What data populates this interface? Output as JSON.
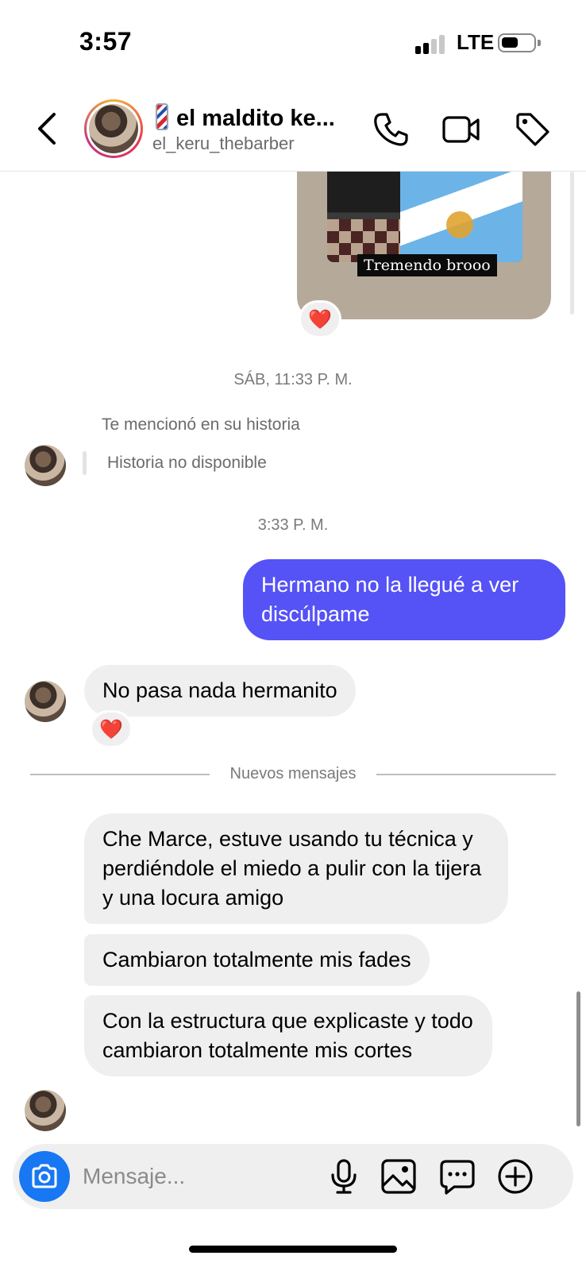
{
  "status_bar": {
    "time": "3:57",
    "network": "LTE",
    "battery_level": 0.4
  },
  "header": {
    "contact_name": "el maldito ke...",
    "contact_username": "el_keru_thebarber",
    "icons": [
      "back-chevron",
      "phone",
      "video-camera",
      "tag"
    ]
  },
  "chat": {
    "story": {
      "caption": "Tremendo brooo",
      "reaction": "❤️"
    },
    "timestamp_1": "SÁB, 11:33 P. M.",
    "mention_text": "Te mencionó en su historia",
    "story_unavailable": "Historia no disponible",
    "timestamp_2": "3:33 P. M.",
    "outgoing_message": "Hermano no la llegué a ver discúlpame",
    "incoming_message_1": "No pasa nada hermanito",
    "incoming_message_1_reaction": "❤️",
    "new_messages_divider": "Nuevos mensajes",
    "incoming_message_2": "Che Marce, estuve usando tu técnica y perdiéndole el miedo a pulir con la tijera y una locura amigo",
    "incoming_message_3": "Cambiaron totalmente mis fades",
    "incoming_message_4": "Con la estructura que explicaste y todo cambiaron totalmente mis cortes"
  },
  "composer": {
    "placeholder": "Mensaje...",
    "icons": [
      "camera",
      "microphone",
      "image",
      "sticker-chat",
      "plus-circle"
    ]
  },
  "colors": {
    "outgoing_bubble": "#5552f6",
    "incoming_bubble": "#efefef",
    "camera_button": "#1877f2"
  }
}
